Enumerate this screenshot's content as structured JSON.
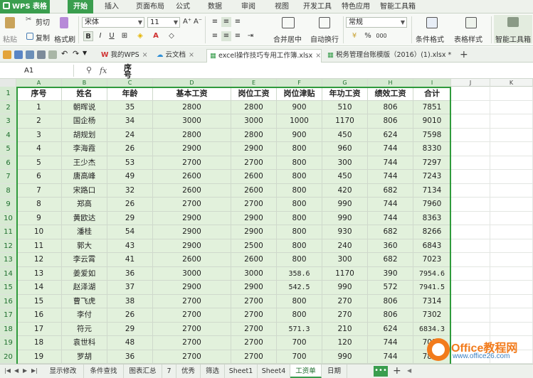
{
  "app": {
    "title": "WPS 表格"
  },
  "menu": {
    "tabs": [
      "开始",
      "插入",
      "页面布局",
      "公式",
      "数据",
      "审阅",
      "视图",
      "开发工具",
      "特色应用",
      "智能工具箱"
    ],
    "active": 0
  },
  "ribbon": {
    "paste_label": "粘贴",
    "cut_label": "剪切",
    "copy_label": "复制",
    "format_painter_label": "格式刷",
    "font_name": "宋体",
    "font_size": "11",
    "merge_label": "合并居中",
    "wrap_label": "自动换行",
    "number_format": "常规",
    "percent_label": "%",
    "thousands_label": "000",
    "cond_format_label": "条件格式",
    "table_style_label": "表格样式",
    "smart_toolbox_label": "智能工具箱"
  },
  "doc_tabs": [
    {
      "label": "我的WPS",
      "icon": "wps-icon"
    },
    {
      "label": "云文档",
      "icon": "cloud-icon"
    },
    {
      "label": "excel操作技巧专用工作簿.xlsx",
      "icon": "sheet-file-icon"
    },
    {
      "label": "税务管理台账模版（2016）(1).xlsx *",
      "icon": "sheet-file-icon"
    }
  ],
  "formula_bar": {
    "name_box": "A1",
    "fx_label": "fx",
    "value": "序号"
  },
  "columns": [
    "A",
    "B",
    "C",
    "D",
    "E",
    "F",
    "G",
    "H",
    "I",
    "J",
    "K"
  ],
  "headers": [
    "序号",
    "姓名",
    "年龄",
    "基本工资",
    "岗位工资",
    "岗位津贴",
    "年功工资",
    "绩效工资",
    "合计"
  ],
  "rows": [
    [
      "1",
      "朝晖说",
      "35",
      "2800",
      "2800",
      "900",
      "510",
      "806",
      "7851"
    ],
    [
      "2",
      "国企杨",
      "34",
      "3000",
      "3000",
      "1000",
      "1170",
      "806",
      "9010"
    ],
    [
      "3",
      "胡规划",
      "24",
      "2800",
      "2800",
      "900",
      "450",
      "624",
      "7598"
    ],
    [
      "4",
      "李海霞",
      "26",
      "2900",
      "2900",
      "800",
      "960",
      "744",
      "8330"
    ],
    [
      "5",
      "王少杰",
      "53",
      "2700",
      "2700",
      "800",
      "300",
      "744",
      "7297"
    ],
    [
      "6",
      "唐高峰",
      "49",
      "2600",
      "2600",
      "800",
      "450",
      "744",
      "7243"
    ],
    [
      "7",
      "宋路口",
      "32",
      "2600",
      "2600",
      "800",
      "420",
      "682",
      "7134"
    ],
    [
      "8",
      "郑高",
      "26",
      "2700",
      "2700",
      "800",
      "990",
      "744",
      "7960"
    ],
    [
      "9",
      "黄欧达",
      "29",
      "2900",
      "2900",
      "800",
      "990",
      "744",
      "8363"
    ],
    [
      "10",
      "潘桂",
      "54",
      "2900",
      "2900",
      "800",
      "930",
      "682",
      "8266"
    ],
    [
      "11",
      "郭大",
      "43",
      "2900",
      "2500",
      "800",
      "240",
      "360",
      "6843"
    ],
    [
      "12",
      "李云霄",
      "41",
      "2600",
      "2600",
      "800",
      "300",
      "682",
      "7023"
    ],
    [
      "13",
      "姜爱如",
      "36",
      "3000",
      "3000",
      "358.6",
      "1170",
      "390",
      "7954.6"
    ],
    [
      "14",
      "赵泽湖",
      "37",
      "2900",
      "2900",
      "542.5",
      "990",
      "572",
      "7941.5"
    ],
    [
      "15",
      "曹飞虎",
      "38",
      "2700",
      "2700",
      "800",
      "270",
      "806",
      "7314"
    ],
    [
      "16",
      "李付",
      "26",
      "2700",
      "2700",
      "800",
      "270",
      "806",
      "7302"
    ],
    [
      "17",
      "符元",
      "29",
      "2700",
      "2700",
      "571.3",
      "210",
      "624",
      "6834.3"
    ],
    [
      "18",
      "袁世科",
      "48",
      "2700",
      "2700",
      "700",
      "120",
      "744",
      "7012"
    ],
    [
      "19",
      "罗胡",
      "36",
      "2700",
      "2700",
      "700",
      "990",
      "744",
      "7870"
    ]
  ],
  "sheet_tabs": [
    "显示修改",
    "条件查找",
    "图表汇总",
    "7",
    "优秀",
    "筛选",
    "Sheet1",
    "Sheet4",
    "工资单",
    "日期"
  ],
  "active_sheet": 8,
  "more_label": "•••",
  "watermark": {
    "brand": "Office教程网",
    "url": "www.office26.com"
  }
}
